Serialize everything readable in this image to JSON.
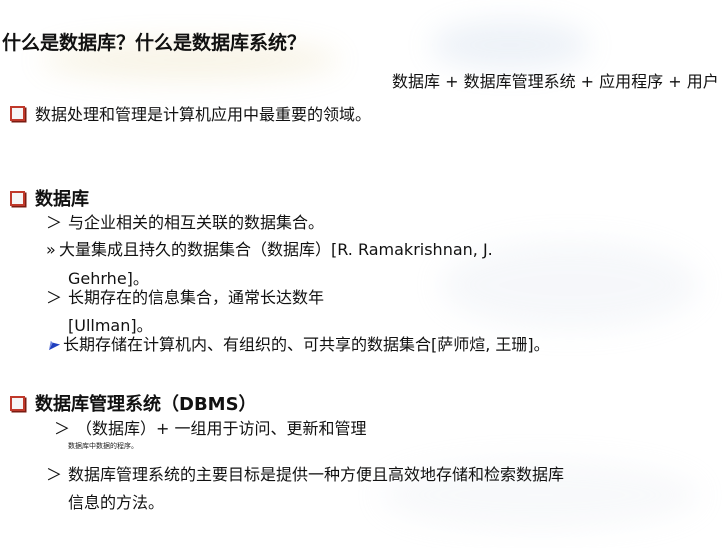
{
  "slide": {
    "title": "什么是数据库？什么是数据库系统？",
    "formula": "数据库 + 数据库管理系统 + 应用程序 + 用户",
    "intro": "数据处理和管理是计算机应用中最重要的领域。",
    "database": {
      "heading": "数据库",
      "items": [
        {
          "marker": ">",
          "text": "与企业相关的相互关联的数据集合。"
        },
        {
          "marker": "»",
          "text": "大量集成且持久的数据集合（数据库）[R. Ramakrishnan, J.",
          "cont": "Gehrhe]。"
        },
        {
          "marker": ">",
          "text": "长期存在的信息集合，通常长达数年",
          "cont": "[Ullman]。"
        },
        {
          "marker": "arrow",
          "text": "长期存储在计算机内、有组织的、可共享的数据集合[萨师煊, 王珊]。"
        }
      ]
    },
    "dbms": {
      "heading": "数据库管理系统（DBMS）",
      "items": [
        {
          "marker": ">",
          "text": "（数据库）+ 一组用于访问、更新和管理",
          "note": "数据库中数据的程序。"
        },
        {
          "marker": ">",
          "text": "数据库管理系统的主要目标是提供一种方便且高效地存储和检索数据库",
          "cont": "信息的方法。"
        }
      ]
    },
    "colors": {
      "bullet_border": "#c0392b",
      "arrow": "#1f3fbf"
    }
  }
}
